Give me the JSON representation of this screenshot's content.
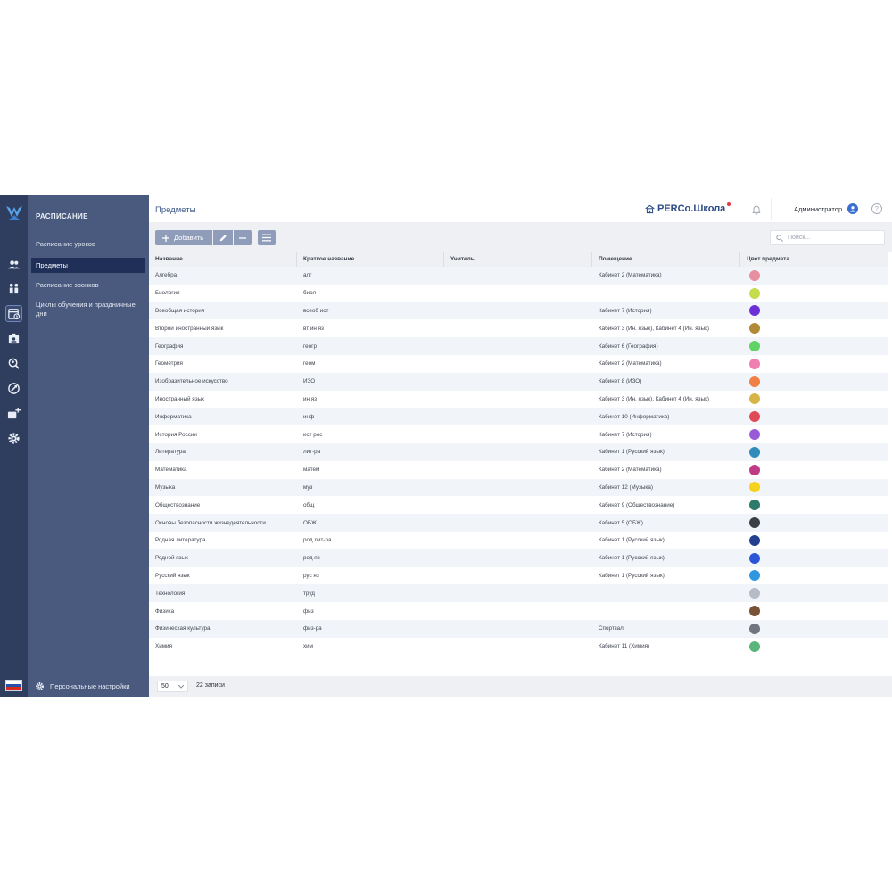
{
  "rail": {
    "icons": [
      "logo-icon",
      "users-icon",
      "groups-icon",
      "schedule-icon",
      "badge-icon",
      "search-person-icon",
      "target-icon",
      "add-card-icon",
      "gear-icon"
    ],
    "flag_colors": [
      "#ffffff",
      "#2a4fa8",
      "#d52b1e"
    ]
  },
  "sidebar": {
    "title": "РАСПИСАНИЕ",
    "items": [
      {
        "label": "Расписание уроков"
      },
      {
        "label": "Предметы"
      },
      {
        "label": "Расписание звонков"
      },
      {
        "label": "Циклы обучения и праздничные дни"
      }
    ],
    "active_index": 1,
    "footer_label": "Персональные настройки"
  },
  "header": {
    "title": "Предметы",
    "brand": "PERCo.Школа",
    "user": "Администратор",
    "help": "?"
  },
  "toolbar": {
    "add_label": "Добавить",
    "search_placeholder": "Поиск..."
  },
  "table": {
    "columns": [
      "Название",
      "Краткое название",
      "Учитель",
      "Помещение",
      "Цвет предмета"
    ],
    "rows": [
      {
        "name": "Алгебра",
        "short": "алг",
        "teacher": "",
        "room": "Кабинет 2 (Математика)",
        "color": "#e68fa0"
      },
      {
        "name": "Биология",
        "short": "биол",
        "teacher": "",
        "room": "",
        "color": "#c4dd4a"
      },
      {
        "name": "Всеобщая история",
        "short": "всеоб ист",
        "teacher": "",
        "room": "Кабинет 7 (История)",
        "color": "#6a2fd6"
      },
      {
        "name": "Второй иностранный язык",
        "short": "вт ин яз",
        "teacher": "",
        "room": "Кабинет 3 (Ин. язык), Кабинет 4 (Ин. язык)",
        "color": "#b08a35"
      },
      {
        "name": "География",
        "short": "геогр",
        "teacher": "",
        "room": "Кабинет 6 (География)",
        "color": "#5fd365"
      },
      {
        "name": "Геометрия",
        "short": "геом",
        "teacher": "",
        "room": "Кабинет 2 (Математика)",
        "color": "#ef7fb0"
      },
      {
        "name": "Изобразительное искусство",
        "short": "ИЗО",
        "teacher": "",
        "room": "Кабинет 8 (ИЗО)",
        "color": "#f08044"
      },
      {
        "name": "Иностранный язык",
        "short": "ин яз",
        "teacher": "",
        "room": "Кабинет 3 (Ин. язык), Кабинет 4 (Ин. язык)",
        "color": "#d8b446"
      },
      {
        "name": "Информатика",
        "short": "инф",
        "teacher": "",
        "room": "Кабинет 10 (Информатика)",
        "color": "#e04a55"
      },
      {
        "name": "История России",
        "short": "ист рос",
        "teacher": "",
        "room": "Кабинет 7 (История)",
        "color": "#9a5ad8"
      },
      {
        "name": "Литература",
        "short": "лит-ра",
        "teacher": "",
        "room": "Кабинет 1 (Русский язык)",
        "color": "#2f8cb8"
      },
      {
        "name": "Математика",
        "short": "матем",
        "teacher": "",
        "room": "Кабинет 2 (Математика)",
        "color": "#c03a86"
      },
      {
        "name": "Музыка",
        "short": "муз",
        "teacher": "",
        "room": "Кабинет 12 (Музыка)",
        "color": "#f4d21e"
      },
      {
        "name": "Обществознание",
        "short": "общ",
        "teacher": "",
        "room": "Кабинет 9 (Обществознание)",
        "color": "#2b7a6a"
      },
      {
        "name": "Основы безопасности жизнедеятельности",
        "short": "ОБЖ",
        "teacher": "",
        "room": "Кабинет 5 (ОБЖ)",
        "color": "#3b4046"
      },
      {
        "name": "Родная литература",
        "short": "род лит-ра",
        "teacher": "",
        "room": "Кабинет 1 (Русский язык)",
        "color": "#22408e"
      },
      {
        "name": "Родной язык",
        "short": "род яз",
        "teacher": "",
        "room": "Кабинет 1 (Русский язык)",
        "color": "#2a55d6"
      },
      {
        "name": "Русский язык",
        "short": "рус яз",
        "teacher": "",
        "room": "Кабинет 1 (Русский язык)",
        "color": "#2f96e0"
      },
      {
        "name": "Технология",
        "short": "труд",
        "teacher": "",
        "room": "",
        "color": "#b5bcc6"
      },
      {
        "name": "Физика",
        "short": "физ",
        "teacher": "",
        "room": "",
        "color": "#7a5235"
      },
      {
        "name": "Физическая культура",
        "short": "физ-ра",
        "teacher": "",
        "room": "Спортзал",
        "color": "#70757e"
      },
      {
        "name": "Химия",
        "short": "хим",
        "teacher": "",
        "room": "Кабинет 11 (Химия)",
        "color": "#5ab57a"
      }
    ]
  },
  "footer": {
    "page_size": "50",
    "records": "22 записи"
  }
}
